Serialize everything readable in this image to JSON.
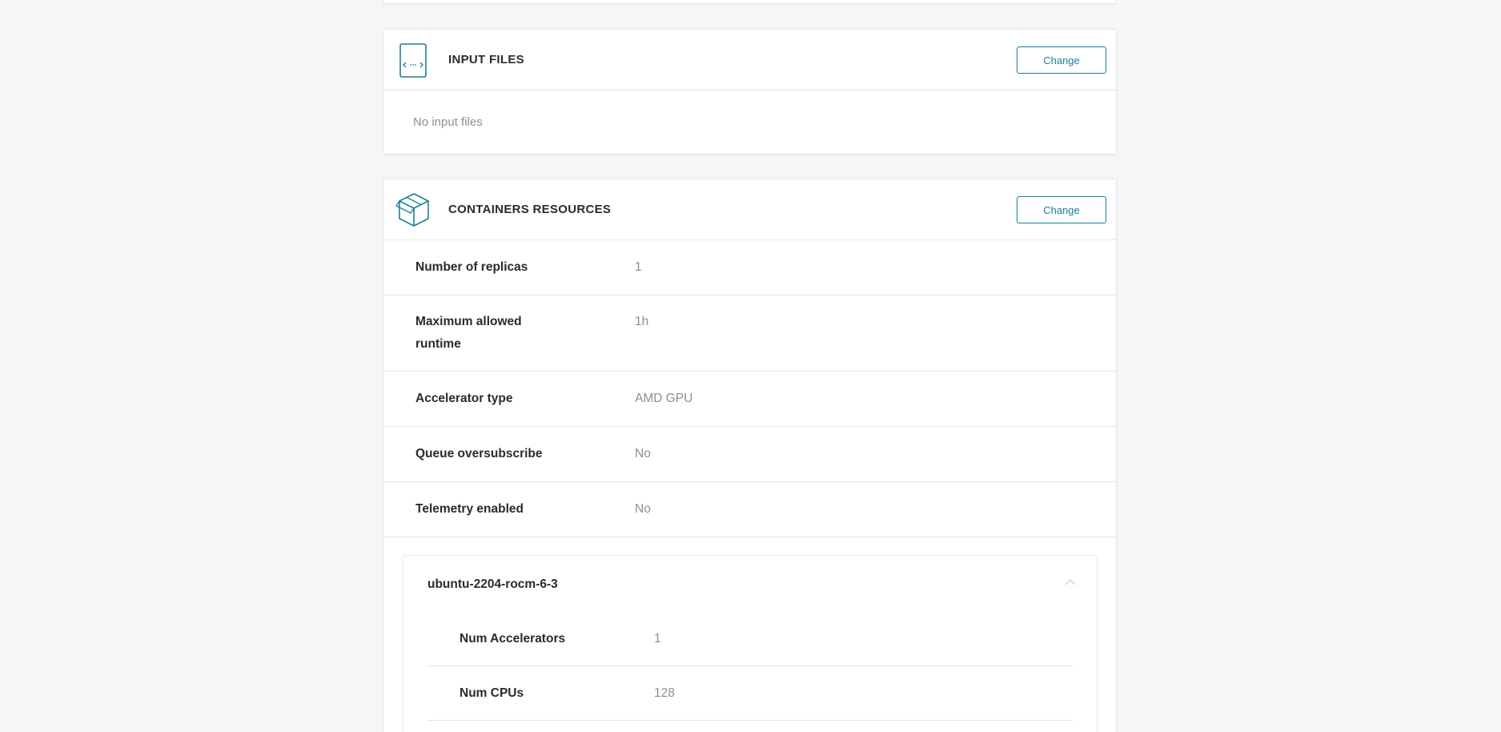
{
  "input_files": {
    "title": "INPUT FILES",
    "change_label": "Change",
    "empty_text": "No input files",
    "icon": "code-file-icon"
  },
  "containers_resources": {
    "title": "CONTAINERS RESOURCES",
    "change_label": "Change",
    "icon": "box-icon",
    "rows": [
      {
        "label": "Number of replicas",
        "value": "1"
      },
      {
        "label": "Maximum allowed runtime",
        "value": "1h"
      },
      {
        "label": "Accelerator type",
        "value": "AMD GPU"
      },
      {
        "label": "Queue oversubscribe",
        "value": "No"
      },
      {
        "label": "Telemetry enabled",
        "value": "No"
      }
    ],
    "container": {
      "name": "ubuntu-2204-rocm-6-3",
      "expanded": true,
      "rows": [
        {
          "label": "Num Accelerators",
          "value": "1"
        },
        {
          "label": "Num CPUs",
          "value": "128"
        }
      ]
    }
  },
  "colors": {
    "accent": "#1a7f93",
    "background": "#f5f6f7",
    "muted_text": "#8a8f94"
  }
}
